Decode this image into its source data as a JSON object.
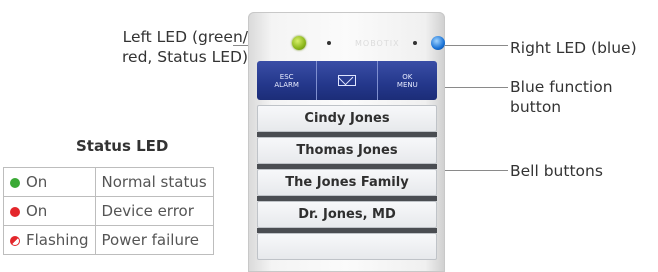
{
  "callouts": {
    "left_led": "Left LED (green/\nred, Status LED)",
    "right_led": "Right LED (blue)",
    "blue_function": "Blue function button",
    "bell_buttons": "Bell buttons"
  },
  "status_led": {
    "title": "Status LED",
    "rows": [
      {
        "state": "On",
        "color": "green",
        "meaning": "Normal status"
      },
      {
        "state": "On",
        "color": "red",
        "meaning": "Device error"
      },
      {
        "state": "Flashing",
        "color": "red",
        "meaning": "Power failure"
      }
    ]
  },
  "device": {
    "brand": "MOBOTIX",
    "function_buttons": {
      "left": "ESC\nALARM",
      "middle_icon": "envelope-icon",
      "right": "OK\nMENU"
    },
    "bell_labels": [
      "Cindy Jones",
      "Thomas Jones",
      "The Jones Family",
      "Dr. Jones, MD",
      ""
    ],
    "led_colors": {
      "left": "#8ab61a",
      "right": "#1a73d6",
      "function_bar": "#24378b"
    }
  }
}
